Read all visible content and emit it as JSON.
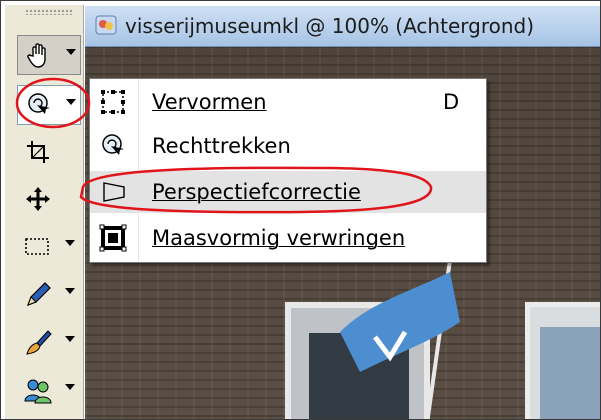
{
  "document": {
    "title": "visserijmuseumkl @ 100% (Achtergrond)"
  },
  "toolbox": {
    "tools": [
      {
        "name": "hand-tool",
        "icon": "hand-icon",
        "has_dropdown": true
      },
      {
        "name": "transform-tool",
        "icon": "transform-icon",
        "has_dropdown": true,
        "selected": true
      },
      {
        "name": "crop-tool",
        "icon": "crop-icon",
        "has_dropdown": false
      },
      {
        "name": "move-tool",
        "icon": "move-icon",
        "has_dropdown": false
      },
      {
        "name": "marquee-tool",
        "icon": "marquee-icon",
        "has_dropdown": true
      },
      {
        "name": "pen-tool",
        "icon": "pen-icon",
        "has_dropdown": true
      },
      {
        "name": "brush-tool",
        "icon": "brush-icon",
        "has_dropdown": true
      },
      {
        "name": "clone-tool",
        "icon": "clone-icon",
        "has_dropdown": true
      }
    ]
  },
  "menu": {
    "items": [
      {
        "label": "Vervormen",
        "shortcut": "D",
        "icon": "transform-box-icon"
      },
      {
        "label": "Rechttrekken",
        "shortcut": "",
        "icon": "straighten-icon"
      },
      {
        "label": "Perspectiefcorrectie",
        "shortcut": "",
        "icon": "perspective-icon",
        "highlighted": true
      },
      {
        "label": "Maasvormig verwringen",
        "shortcut": "",
        "icon": "mesh-warp-icon"
      }
    ]
  },
  "colors": {
    "annotation_red": "#e0141b",
    "menu_highlight": "#e3e3e3",
    "titlebar_start": "#cfe0f3",
    "titlebar_end": "#a7c4e6"
  }
}
